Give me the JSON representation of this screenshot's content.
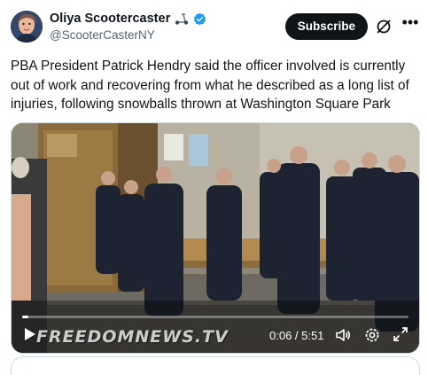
{
  "author": {
    "display_name": "Oliya Scootercaster",
    "handle": "@ScooterCasterNY",
    "badge_icon": "scooter-icon",
    "verified_icon": "verified-icon",
    "verified_color": "#1d9bf0"
  },
  "actions": {
    "subscribe_label": "Subscribe",
    "grok_icon": "grok-icon",
    "more_icon": "more-icon"
  },
  "tweet": {
    "text": "PBA President Patrick Hendry said the officer involved is currently out of work and recovering from what he described as a long list of injuries, following snowballs thrown at Washington Square Park"
  },
  "video": {
    "watermark": "FREEDOMNEWS.TV",
    "current_time": "0:06",
    "duration": "5:51",
    "time_display": "0:06 / 5:51",
    "progress": 0.017,
    "controls": [
      "play-icon",
      "volume-icon",
      "settings-icon",
      "fullscreen-icon"
    ]
  },
  "colors": {
    "text_primary": "#0f1419",
    "text_secondary": "#536471",
    "button_bg": "#0f1419",
    "border": "#cfd9de"
  }
}
